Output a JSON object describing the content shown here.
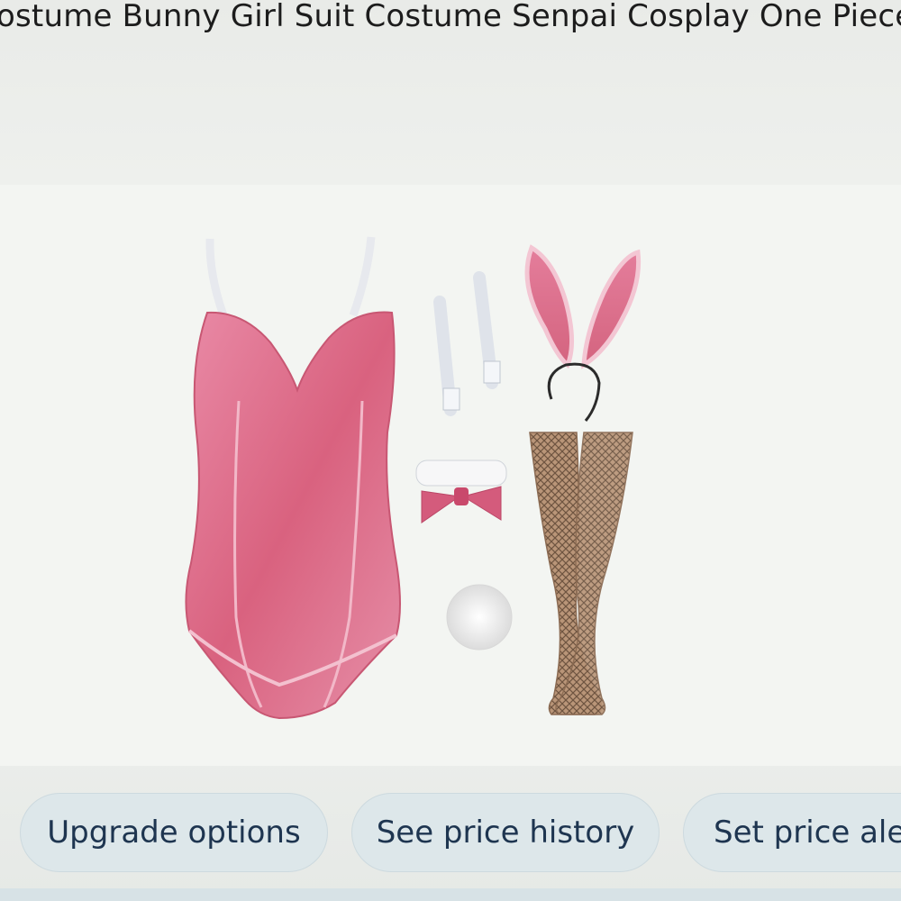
{
  "product": {
    "title": "ostume Bunny Girl Suit Costume Senpai Cosplay One Piece"
  },
  "image": {
    "subject": "pink bunny girl costume set",
    "accent_color": "#e07a99",
    "items": [
      "bodysuit",
      "wrist-cuffs",
      "bunny-ears-headband",
      "bow-tie-collar",
      "tail",
      "fishnet-stockings"
    ]
  },
  "actions": {
    "upgrade_label": "Upgrade options",
    "price_history_label": "See price history",
    "price_alert_label": "Set price ale"
  }
}
